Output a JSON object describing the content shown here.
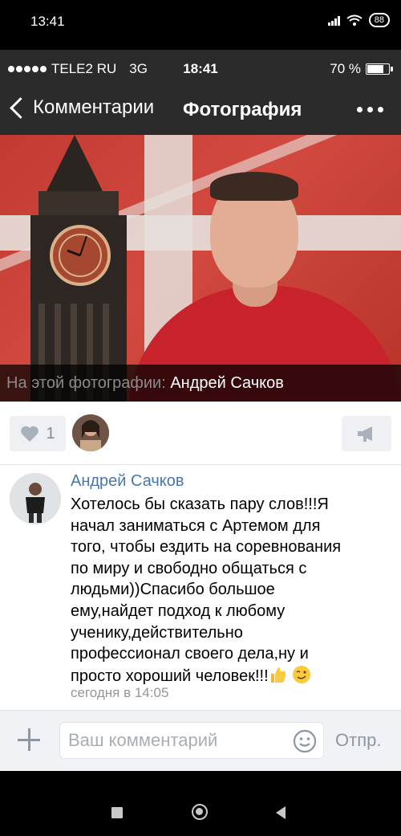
{
  "android_status": {
    "time": "13:41",
    "battery": "88"
  },
  "ios_status": {
    "carrier": "TELE2 RU",
    "network": "3G",
    "time": "18:41",
    "battery": "70 %",
    "battery_level": 0.7
  },
  "nav": {
    "back_label": "Комментарии",
    "title": "Фотография"
  },
  "photo": {
    "caption_prefix": "На этой фотографии:",
    "caption_name": "Андрей Сачков"
  },
  "likes": {
    "count": "1"
  },
  "comment": {
    "author": "Андрей Сачков",
    "text": "Хотелось бы сказать пару слов!!!Я\nначал заниматься с Артемом для\nтого, чтобы ездить на соревнования\nпо миру и свободно общаться с\nлюдьми))Спасибо большое\nему,найдет подход к любому\nученику,действительно\nпрофессионал своего дела,ну и\nпросто хороший человек!!!",
    "time": "сегодня в 14:05"
  },
  "input": {
    "placeholder": "Ваш комментарий",
    "send_label": "Отпр."
  },
  "colors": {
    "link": "#4a76a8",
    "header_bg": "#2b2b2b",
    "icon_gray": "#8d97a3"
  },
  "icons": [
    "signal-icon",
    "wifi-icon",
    "battery-icon",
    "back-chevron-icon",
    "more-icon",
    "heart-icon",
    "megaphone-icon",
    "thumbs-up-emoji",
    "wink-emoji",
    "plus-icon",
    "smile-icon",
    "square-icon",
    "home-icon",
    "triangle-back-icon"
  ]
}
